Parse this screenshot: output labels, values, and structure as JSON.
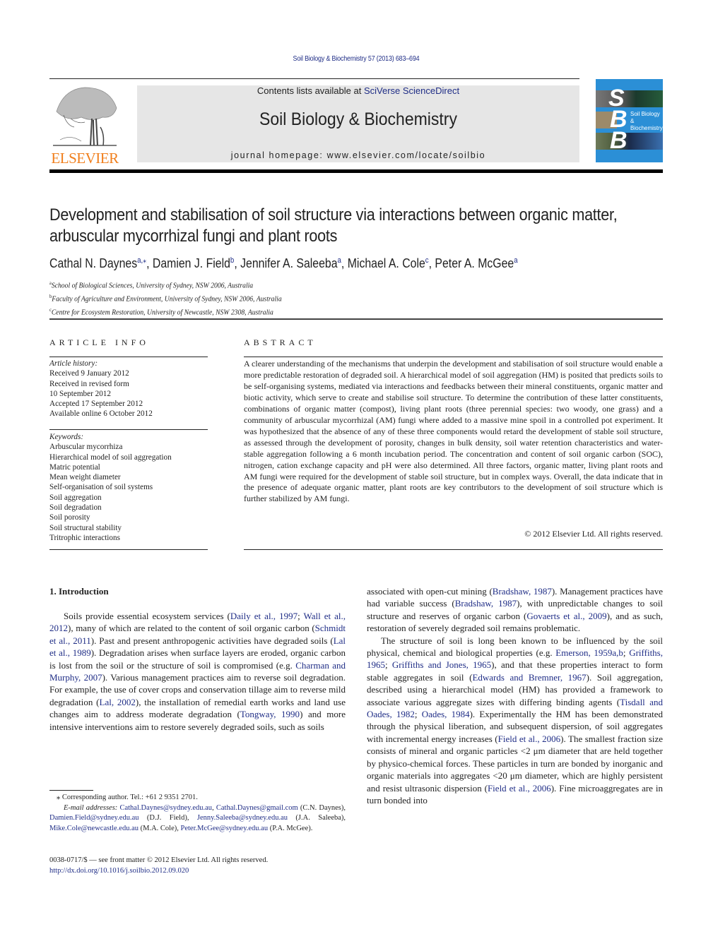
{
  "running_head": "Soil Biology & Biochemistry 57 (2013) 683–694",
  "header": {
    "publisher_logo": "ELSEVIER",
    "contents_prefix": "Contents lists available at ",
    "contents_link": "SciVerse ScienceDirect",
    "journal_title": "Soil Biology & Biochemistry",
    "homepage_prefix": "journal homepage: ",
    "homepage_url": "www.elsevier.com/locate/soilbio",
    "cover": {
      "letters": [
        "S",
        "B",
        "B"
      ],
      "title_line1": "Soil Biology &",
      "title_line2": "Biochemistry",
      "bg_color": "#2b8fd6"
    }
  },
  "article": {
    "title": "Development and stabilisation of soil structure via interactions between organic matter, arbuscular mycorrhizal fungi and plant roots",
    "authors": [
      {
        "name": "Cathal N. Daynes",
        "sup": "a,⁎",
        "sep": ", "
      },
      {
        "name": "Damien J. Field",
        "sup": "b",
        "sep": ", "
      },
      {
        "name": "Jennifer A. Saleeba",
        "sup": "a",
        "sep": ", "
      },
      {
        "name": "Michael A. Cole",
        "sup": "c",
        "sep": ", "
      },
      {
        "name": "Peter A. McGee",
        "sup": "a",
        "sep": ""
      }
    ],
    "affiliations": [
      {
        "key": "a",
        "text": "School of Biological Sciences, University of Sydney, NSW 2006, Australia"
      },
      {
        "key": "b",
        "text": "Faculty of Agriculture and Environment, University of Sydney, NSW 2006, Australia"
      },
      {
        "key": "c",
        "text": "Centre for Ecosystem Restoration, University of Newcastle, NSW 2308, Australia"
      }
    ]
  },
  "article_info": {
    "heading": "ARTICLE INFO",
    "history_label": "Article history:",
    "history": [
      "Received 9 January 2012",
      "Received in revised form",
      "10 September 2012",
      "Accepted 17 September 2012",
      "Available online 6 October 2012"
    ],
    "keywords_label": "Keywords:",
    "keywords": [
      "Arbuscular mycorrhiza",
      "Hierarchical model of soil aggregation",
      "Matric potential",
      "Mean weight diameter",
      "Self-organisation of soil systems",
      "Soil aggregation",
      "Soil degradation",
      "Soil porosity",
      "Soil structural stability",
      "Tritrophic interactions"
    ]
  },
  "abstract": {
    "heading": "ABSTRACT",
    "text": "A clearer understanding of the mechanisms that underpin the development and stabilisation of soil structure would enable a more predictable restoration of degraded soil. A hierarchical model of soil aggregation (HM) is posited that predicts soils to be self-organising systems, mediated via interactions and feedbacks between their mineral constituents, organic matter and biotic activity, which serve to create and stabilise soil structure. To determine the contribution of these latter constituents, combina­tions of organic matter (compost), living plant roots (three perennial species: two woody, one grass) and a community of arbuscular mycorrhizal (AM) fungi where added to a massive mine spoil in a controlled pot experiment. It was hypothesized that the absence of any of these three components would retard the development of stable soil structure, as assessed through the development of porosity, changes in bulk density, soil water retention characteristics and water-stable aggregation following a 6 month incubation period. The concentration and content of soil organic carbon (SOC), nitrogen, cation exchange capacity and pH were also determined. All three factors, organic matter, living plant roots and AM fungi were required for the development of stable soil structure, but in complex ways. Overall, the data indicate that in the presence of adequate organic matter, plant roots are key contributors to the development of soil structure which is further stabilized by AM fungi.",
    "copyright": "© 2012 Elsevier Ltd. All rights reserved."
  },
  "introduction": {
    "heading": "1.  Introduction",
    "left_paragraphs": [
      [
        {
          "t": "Soils provide essential ecosystem services ("
        },
        {
          "l": "Daily et al., 1997"
        },
        {
          "t": "; "
        },
        {
          "l": "Wall et al., 2012"
        },
        {
          "t": "), many of which are related to the content of soil organic carbon ("
        },
        {
          "l": "Schmidt et al., 2011"
        },
        {
          "t": "). Past and present anthropo­genic activities have degraded soils ("
        },
        {
          "l": "Lal et al., 1989"
        },
        {
          "t": "). Degradation arises when surface layers are eroded, organic carbon is lost from the soil or the structure of soil is compromised (e.g. "
        },
        {
          "l": "Charman and Murphy, 2007"
        },
        {
          "t": "). Various management practices aim to reverse soil degradation. For example, the use of cover crops and conservation tillage aim to reverse mild degradation ("
        },
        {
          "l": "Lal, 2002"
        },
        {
          "t": "), the installation of remedial earth works and land use changes aim to address moderate degradation ("
        },
        {
          "l": "Tongway, 1990"
        },
        {
          "t": ") and more intensive inter­ventions aim to restore severely degraded soils, such as soils"
        }
      ]
    ],
    "right_paragraphs": [
      [
        {
          "t": "associated with open-cut mining ("
        },
        {
          "l": "Bradshaw, 1987"
        },
        {
          "t": "). Management practices have had variable success ("
        },
        {
          "l": "Bradshaw, 1987"
        },
        {
          "t": "), with unpre­dictable changes to soil structure and reserves of organic carbon ("
        },
        {
          "l": "Govaerts et al., 2009"
        },
        {
          "t": "), and as such, restoration of severely degraded soil remains problematic."
        }
      ],
      [
        {
          "t": "The structure of soil is long been known to be influenced by the soil physical, chemical and biological properties (e.g. "
        },
        {
          "l": "Emerson, 1959a,b"
        },
        {
          "t": "; "
        },
        {
          "l": "Griffiths, 1965"
        },
        {
          "t": "; "
        },
        {
          "l": "Griffiths and Jones, 1965"
        },
        {
          "t": "), and that these properties interact to form stable aggregates in soil ("
        },
        {
          "l": "Edwards and Bremner, 1967"
        },
        {
          "t": "). Soil aggregation, described using a hierarchical model (HM) has provided a framework to associate various aggregate sizes with differing binding agents ("
        },
        {
          "l": "Tisdall and Oades, 1982"
        },
        {
          "t": "; "
        },
        {
          "l": "Oades, 1984"
        },
        {
          "t": "). Experimentally the HM has been demonstrated through the physical liberation, and subsequent dispersion, of soil aggregates with incremental energy increases ("
        },
        {
          "l": "Field et al., 2006"
        },
        {
          "t": "). The smallest fraction size consists of mineral and organic particles <2 μm diameter that are held together by physico-chemical forces. These particles in turn are bonded by inorganic and organic materials into aggregates <20 μm diameter, which are highly persistent and resist ultrasonic dispersion ("
        },
        {
          "l": "Field et al., 2006"
        },
        {
          "t": "). Fine microaggregates are in turn bonded into"
        }
      ]
    ]
  },
  "footnotes": {
    "corresponding": "⁎  Corresponding author. Tel.: +61 2 9351 2701.",
    "email_label": "E-mail addresses: ",
    "emails": [
      {
        "l": "Cathal.Daynes@sydney.edu.au",
        "t": ", "
      },
      {
        "l": "Cathal.Daynes@gmail.com",
        "t": " (C.N. Daynes), "
      },
      {
        "l": "Damien.Field@sydney.edu.au",
        "t": " (D.J. Field), "
      },
      {
        "l": "Jenny.Saleeba@sydney.edu.au",
        "t": " (J.A. Saleeba), "
      },
      {
        "l": "Mike.Cole@newcastle.edu.au",
        "t": " (M.A. Cole), "
      },
      {
        "l": "Peter.McGee@sydney.edu.au",
        "t": " (P.A. McGee)."
      }
    ],
    "front_matter": "0038-0717/$ — see front matter © 2012 Elsevier Ltd. All rights reserved.",
    "doi": "http://dx.doi.org/10.1016/j.soilbio.2012.09.020"
  },
  "colors": {
    "link": "#1f2d86",
    "elsevier_orange": "#f07f1d",
    "band_grey": "#e6e6e6"
  }
}
